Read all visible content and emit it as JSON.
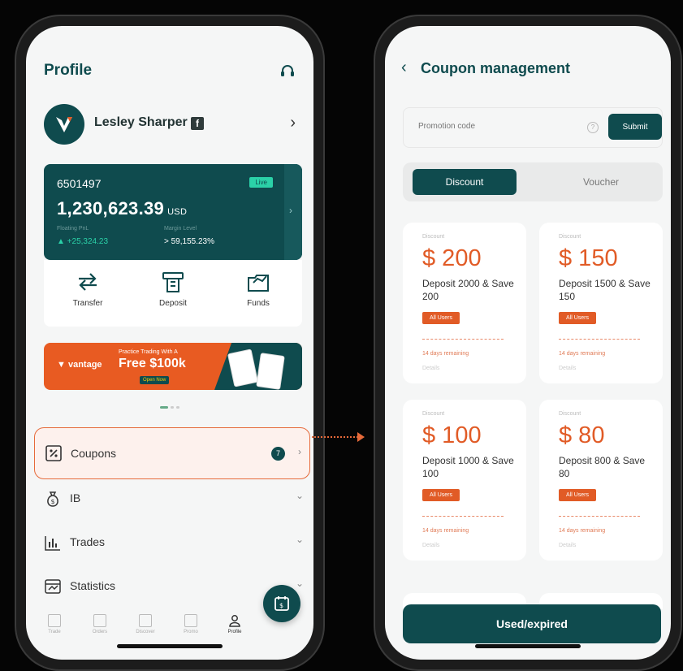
{
  "left_screen": {
    "title": "Profile",
    "user_name": "Lesley Sharper",
    "account": {
      "id": "6501497",
      "status": "Live",
      "balance": "1,230,623.39",
      "currency": "USD",
      "floating_label": "Floating PnL",
      "floating_value": "+25,324.23",
      "margin_label": "Margin Level",
      "margin_value": "> 59,155.23%"
    },
    "actions": [
      {
        "label": "Transfer",
        "icon": "transfer-icon"
      },
      {
        "label": "Deposit",
        "icon": "deposit-icon"
      },
      {
        "label": "Funds",
        "icon": "funds-icon"
      }
    ],
    "banner": {
      "logo": "vantage",
      "small_text": "Practice Trading With A",
      "big_text": "Free $100k",
      "tag": "Open Now"
    },
    "menu": [
      {
        "label": "Coupons",
        "icon": "coupon-icon",
        "count": "7"
      },
      {
        "label": "IB",
        "icon": "moneybag-icon"
      },
      {
        "label": "Trades",
        "icon": "trades-chart-icon"
      },
      {
        "label": "Statistics",
        "icon": "statistics-icon"
      }
    ],
    "tabs": [
      {
        "label": "Trade"
      },
      {
        "label": "Orders"
      },
      {
        "label": "Discover"
      },
      {
        "label": "Promo"
      },
      {
        "label": "Profile"
      }
    ]
  },
  "right_screen": {
    "title": "Coupon management",
    "promo_placeholder": "Promotion code",
    "submit_label": "Submit",
    "segments": [
      "Discount",
      "Voucher"
    ],
    "coupons": [
      {
        "type": "Discount",
        "amount": "$ 200",
        "desc": "Deposit 2000 & Save 200",
        "badge": "All Users",
        "remaining": "14 days remaining",
        "details": "Details"
      },
      {
        "type": "Discount",
        "amount": "$ 150",
        "desc": "Deposit 1500 & Save 150",
        "badge": "All Users",
        "remaining": "14 days remaining",
        "details": "Details"
      },
      {
        "type": "Discount",
        "amount": "$ 100",
        "desc": "Deposit 1000 & Save 100",
        "badge": "All Users",
        "remaining": "14 days remaining",
        "details": "Details"
      },
      {
        "type": "Discount",
        "amount": "$ 80",
        "desc": "Deposit 800 & Save 80",
        "badge": "All Users",
        "remaining": "14 days remaining",
        "details": "Details"
      }
    ],
    "used_button": "Used/expired"
  },
  "colors": {
    "brand_teal": "#0f4b4e",
    "accent_orange": "#e15b26",
    "highlight_border": "#e66a3a"
  }
}
